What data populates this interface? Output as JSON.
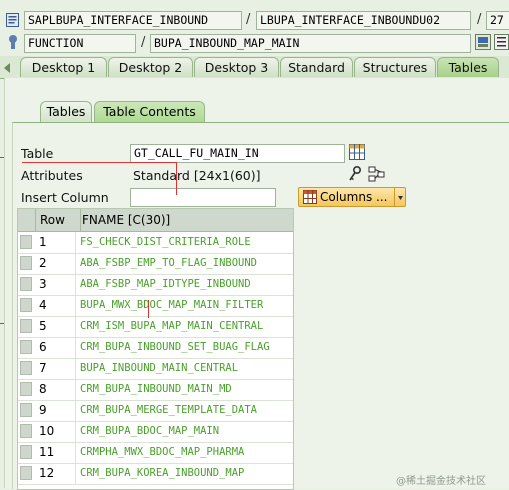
{
  "header": {
    "program": "SAPLBUPA_INTERFACE_INBOUND",
    "sep1": "/",
    "include": "LBUPA_INTERFACE_INBOUNDU02",
    "sep2": "/",
    "line": "27",
    "object_type": "FUNCTION",
    "sep3": "/",
    "object_name": "BUPA_INBOUND_MAP_MAIN"
  },
  "main_tabs": [
    "Desktop 1",
    "Desktop 2",
    "Desktop 3",
    "Standard",
    "Structures",
    "Tables"
  ],
  "sub_tabs": [
    "Tables",
    "Table Contents"
  ],
  "form": {
    "table_label": "Table",
    "table_value": "GT_CALL_FU_MAIN_IN",
    "attributes_label": "Attributes",
    "attributes_value": "Standard [24x1(60)]",
    "insert_column_label": "Insert Column",
    "insert_column_value": "",
    "columns_button": "Columns ..."
  },
  "grid": {
    "headers": [
      "Row",
      "FNAME [C(30)]"
    ],
    "rows": [
      {
        "row": "1",
        "fname": "FS_CHECK_DIST_CRITERIA_ROLE"
      },
      {
        "row": "2",
        "fname": "ABA_FSBP_EMP_TO_FLAG_INBOUND"
      },
      {
        "row": "3",
        "fname": "ABA_FSBP_MAP_IDTYPE_INBOUND"
      },
      {
        "row": "4",
        "fname": "BUPA_MWX_BDOC_MAP_MAIN_FILTER"
      },
      {
        "row": "5",
        "fname": "CRM_ISM_BUPA_MAP_MAIN_CENTRAL"
      },
      {
        "row": "6",
        "fname": "CRM_BUPA_INBOUND_SET_BUAG_FLAG"
      },
      {
        "row": "7",
        "fname": "BUPA_INBOUND_MAIN_CENTRAL"
      },
      {
        "row": "8",
        "fname": "CRM_BUPA_INBOUND_MAIN_MD"
      },
      {
        "row": "9",
        "fname": "CRM_BUPA_MERGE_TEMPLATE_DATA"
      },
      {
        "row": "10",
        "fname": "CRM_BUPA_BDOC_MAP_MAIN"
      },
      {
        "row": "11",
        "fname": "CRMPHA_MWX_BDOC_MAP_PHARMA"
      },
      {
        "row": "12",
        "fname": "CRM_BUPA_KOREA_INBOUND_MAP"
      }
    ]
  },
  "watermark": "@稀土掘金技术社区",
  "colors": {
    "value_text": "#4aa02c",
    "active_tab": "#addb90",
    "button": "#f4c65d"
  }
}
